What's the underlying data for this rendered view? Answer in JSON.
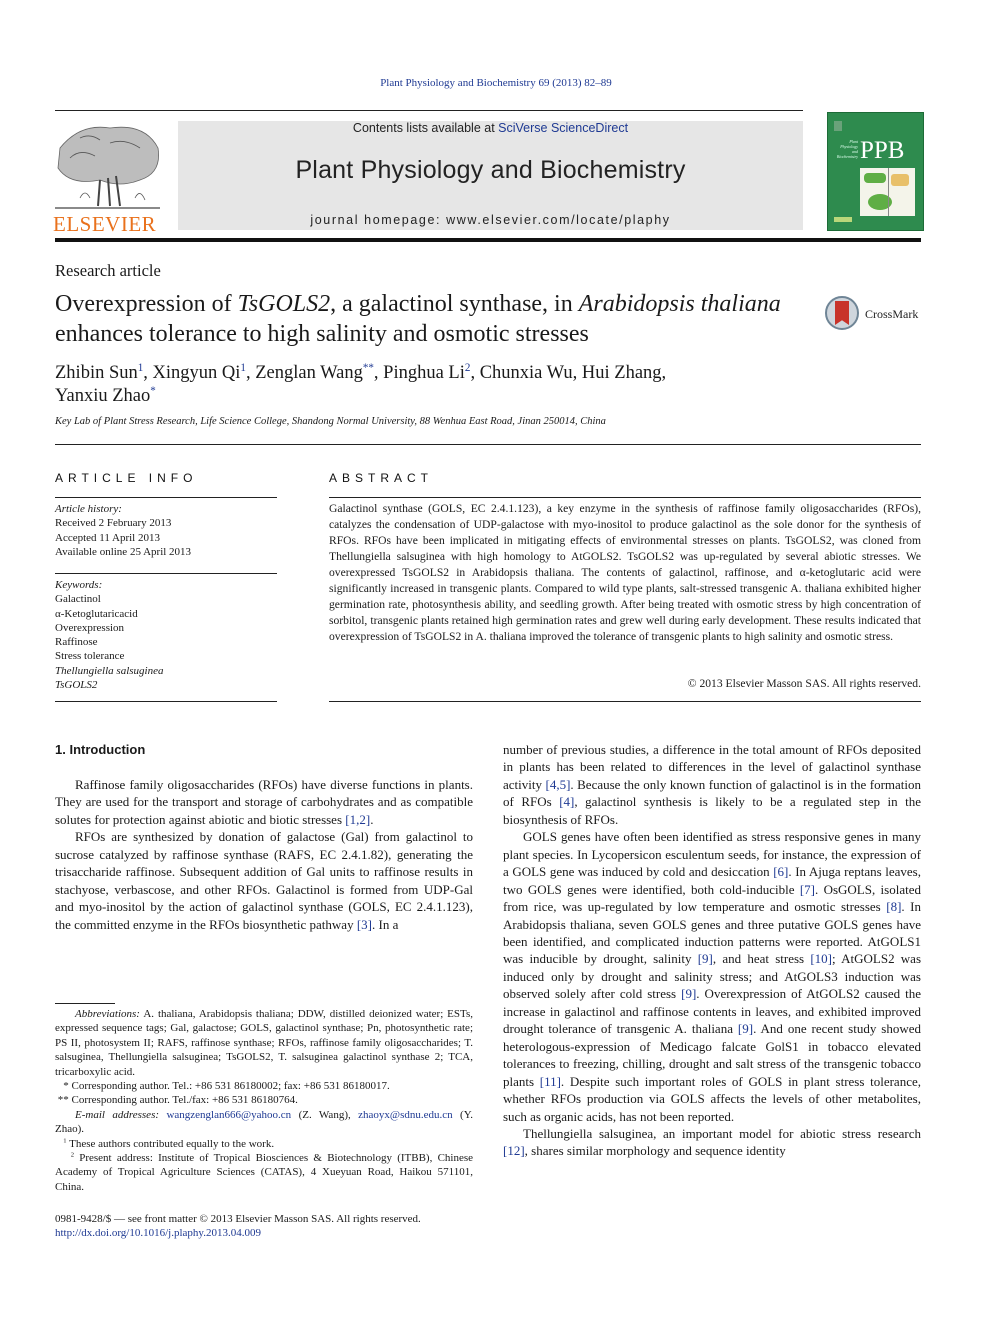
{
  "header": {
    "journal_citation": "Plant Physiology and Biochemistry 69 (2013) 82–89",
    "contents_prefix": "Contents lists available at ",
    "contents_link": "SciVerse ScienceDirect",
    "journal_title": "Plant Physiology and Biochemistry",
    "homepage": "journal homepage: www.elsevier.com/locate/plaphy",
    "publisher_logo_text": "ELSEVIER",
    "cover_text": "PPB",
    "cover_subtitle": "Plant Physiology and Biochemistry",
    "crossmark_label": "CrossMark",
    "icons": {
      "publisher_logo": "elsevier-tree-icon",
      "cover": "journal-cover-icon",
      "crossmark": "crossmark-icon"
    },
    "colors": {
      "elsevier_orange": "#e9711c",
      "cover_green": "#2e8b4e",
      "link_blue": "#1f3a93",
      "masthead_gray": "#e6e6e6"
    }
  },
  "article": {
    "type": "Research article",
    "title": {
      "p1": "Overexpression of ",
      "i1": "TsGOLS2",
      "p2": ", a galactinol synthase, in ",
      "i2": "Arabidopsis thaliana",
      "p3": " enhances tolerance to high salinity and osmotic stresses"
    },
    "authors": [
      {
        "name": "Zhibin Sun",
        "mark": "1",
        "sep": ", "
      },
      {
        "name": "Xingyun Qi",
        "mark": "1",
        "sep": ", "
      },
      {
        "name": "Zenglan Wang",
        "mark": "**",
        "sep": ", "
      },
      {
        "name": "Pinghua Li",
        "mark": "2",
        "sep": ", "
      },
      {
        "name": "Chunxia Wu",
        "mark": "",
        "sep": ", "
      },
      {
        "name": "Hui Zhang",
        "mark": "",
        "sep": ", "
      },
      {
        "name": "Yanxiu Zhao",
        "mark": "*",
        "sep": ""
      }
    ],
    "affiliation": "Key Lab of Plant Stress Research, Life Science College, Shandong Normal University, 88 Wenhua East Road, Jinan 250014, China"
  },
  "article_info": {
    "heading": "ARTICLE INFO",
    "history_label": "Article history:",
    "history": [
      "Received 2 February 2013",
      "Accepted 11 April 2013",
      "Available online 25 April 2013"
    ],
    "keywords_label": "Keywords:",
    "keywords": [
      "Galactinol",
      "α-Ketoglutaricacid",
      "Overexpression",
      "Raffinose",
      "Stress tolerance",
      "Thellungiella salsuginea",
      "TsGOLS2"
    ]
  },
  "abstract": {
    "heading": "ABSTRACT",
    "text": "Galactinol synthase (GOLS, EC 2.4.1.123), a key enzyme in the synthesis of raffinose family oligosaccharides (RFOs), catalyzes the condensation of UDP-galactose with myo-inositol to produce galactinol as the sole donor for the synthesis of RFOs. RFOs have been implicated in mitigating effects of environmental stresses on plants. TsGOLS2, was cloned from Thellungiella salsuginea with high homology to AtGOLS2. TsGOLS2 was up-regulated by several abiotic stresses. We overexpressed TsGOLS2 in Arabidopsis thaliana. The contents of galactinol, raffinose, and α-ketoglutaric acid were significantly increased in transgenic plants. Compared to wild type plants, salt-stressed transgenic A. thaliana exhibited higher germination rate, photosynthesis ability, and seedling growth. After being treated with osmotic stress by high concentration of sorbitol, transgenic plants retained high germination rates and grew well during early development. These results indicated that overexpression of TsGOLS2 in A. thaliana improved the tolerance of transgenic plants to high salinity and osmotic stress.",
    "copyright": "© 2013 Elsevier Masson SAS. All rights reserved."
  },
  "body": {
    "intro_heading": "1.  Introduction",
    "left_paragraphs": [
      "Raffinose family oligosaccharides (RFOs) have diverse functions in plants. They are used for the transport and storage of carbohydrates and as compatible solutes for protection against abiotic and biotic stresses [1,2].",
      "RFOs are synthesized by donation of galactose (Gal) from galactinol to sucrose catalyzed by raffinose synthase (RAFS, EC 2.4.1.82), generating the trisaccharide raffinose. Subsequent addition of Gal units to raffinose results in stachyose, verbascose, and other RFOs. Galactinol is formed from UDP-Gal and myo-inositol by the action of galactinol synthase (GOLS, EC 2.4.1.123), the committed enzyme in the RFOs biosynthetic pathway [3]. In a"
    ],
    "right_paragraphs": [
      "number of previous studies, a difference in the total amount of RFOs deposited in plants has been related to differences in the level of galactinol synthase activity [4,5]. Because the only known function of galactinol is in the formation of RFOs [4], galactinol synthesis is likely to be a regulated step in the biosynthesis of RFOs.",
      "GOLS genes have often been identified as stress responsive genes in many plant species. In Lycopersicon esculentum seeds, for instance, the expression of a GOLS gene was induced by cold and desiccation [6]. In Ajuga reptans leaves, two GOLS genes were identified, both cold-inducible [7]. OsGOLS, isolated from rice, was up-regulated by low temperature and osmotic stresses [8]. In Arabidopsis thaliana, seven GOLS genes and three putative GOLS genes have been identified, and complicated induction patterns were reported. AtGOLS1 was inducible by drought, salinity [9], and heat stress [10]; AtGOLS2 was induced only by drought and salinity stress; and AtGOLS3 induction was observed solely after cold stress [9]. Overexpression of AtGOLS2 caused the increase in galactinol and raffinose contents in leaves, and exhibited improved drought tolerance of transgenic A. thaliana [9]. And one recent study showed heterologous-expression of Medicago falcate GolS1 in tobacco elevated tolerances to freezing, chilling, drought and salt stress of the transgenic tobacco plants [11]. Despite such important roles of GOLS in plant stress tolerance, whether RFOs production via GOLS affects the levels of other metabolites, such as organic acids, has not been reported.",
      "Thellungiella salsuginea, an important model for abiotic stress research [12], shares similar morphology and sequence identity"
    ]
  },
  "footnotes": {
    "abbreviations_label": "Abbreviations:",
    "abbreviations": "A. thaliana, Arabidopsis thaliana; DDW, distilled deionized water; ESTs, expressed sequence tags; Gal, galactose; GOLS, galactinol synthase; Pn, photosynthetic rate; PS II, photosystem II; RAFS, raffinose synthase; RFOs, raffinose family oligosaccharides; T. salsuginea, Thellungiella salsuginea; TsGOLS2, T. salsuginea galactinol synthase 2; TCA, tricarboxylic acid.",
    "corr1_mark": "*",
    "corr1": "Corresponding author. Tel.: +86 531 86180002; fax: +86 531 86180017.",
    "corr2_mark": "**",
    "corr2": "Corresponding author. Tel./fax: +86 531 86180764.",
    "email_label": "E-mail addresses:",
    "email1": "wangzenglan666@yahoo.cn",
    "email1_owner": " (Z. Wang), ",
    "email2": "zhaoyx@sdnu.edu.cn",
    "email2_owner": " (Y. Zhao).",
    "note1_mark": "1",
    "note1": "These authors contributed equally to the work.",
    "note2_mark": "2",
    "note2": "Present address: Institute of Tropical Biosciences & Biotechnology (ITBB), Chinese Academy of Tropical Agriculture Sciences (CATAS), 4 Xueyuan Road, Haikou 571101, China.",
    "front_matter": "0981-9428/$ — see front matter © 2013 Elsevier Masson SAS. All rights reserved.",
    "doi": "http://dx.doi.org/10.1016/j.plaphy.2013.04.009"
  }
}
